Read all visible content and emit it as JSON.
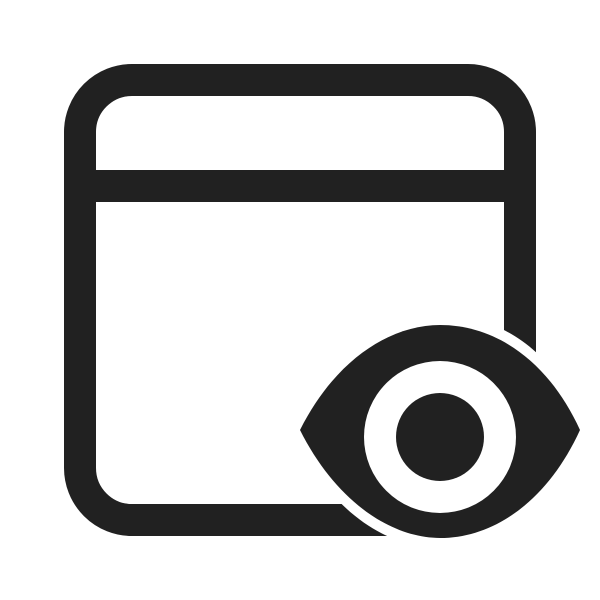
{
  "icon": {
    "name": "window-eye-icon",
    "components": [
      "window-frame",
      "title-bar-divider",
      "eye-overlay"
    ],
    "colors": {
      "stroke": "#212121",
      "background": "#ffffff"
    }
  }
}
